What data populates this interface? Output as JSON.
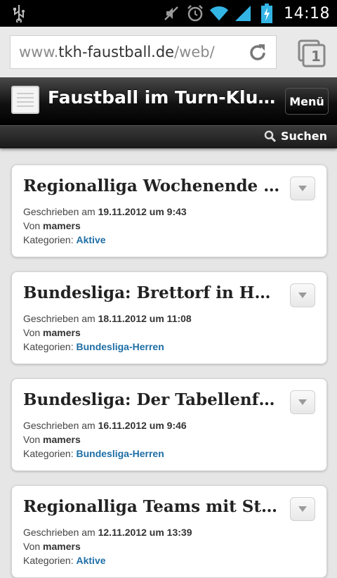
{
  "status_bar": {
    "time": "14:18",
    "icons": [
      "usb-icon",
      "mute-icon",
      "alarm-icon",
      "wifi-icon",
      "signal-icon",
      "battery-charging-icon"
    ]
  },
  "browser": {
    "url_prefix": "www.",
    "url_host": "tkh-faustball.de",
    "url_path": "/web/",
    "tab_count": "1"
  },
  "site": {
    "title": "Faustball im Turn-Klubb zu Hannover",
    "menu_label": "Menü",
    "search_label": "Suchen"
  },
  "posts": [
    {
      "title": "Regionalliga Wochenende – Verbandsliga",
      "written_label": "Geschrieben am",
      "date": "19.11.2012 um 9:43",
      "by_label": "Von",
      "author": "mamers",
      "categories_label": "Kategorien:",
      "category": "Aktive"
    },
    {
      "title": "Bundesliga: Brettorf in Hannover zu Gast",
      "written_label": "Geschrieben am",
      "date": "18.11.2012 um 11:08",
      "by_label": "Von",
      "author": "mamers",
      "categories_label": "Kategorien:",
      "category": "Bundesliga-Herren"
    },
    {
      "title": "Bundesliga: Der Tabellenführer auf Reisen",
      "written_label": "Geschrieben am",
      "date": "16.11.2012 um 9:46",
      "by_label": "Von",
      "author": "mamers",
      "categories_label": "Kategorien:",
      "category": "Bundesliga-Herren"
    },
    {
      "title": "Regionalliga Teams mit Startschwierigkeiten",
      "written_label": "Geschrieben am",
      "date": "12.11.2012 um 13:39",
      "by_label": "Von",
      "author": "mamers",
      "categories_label": "Kategorien:",
      "category": "Aktive"
    }
  ]
}
